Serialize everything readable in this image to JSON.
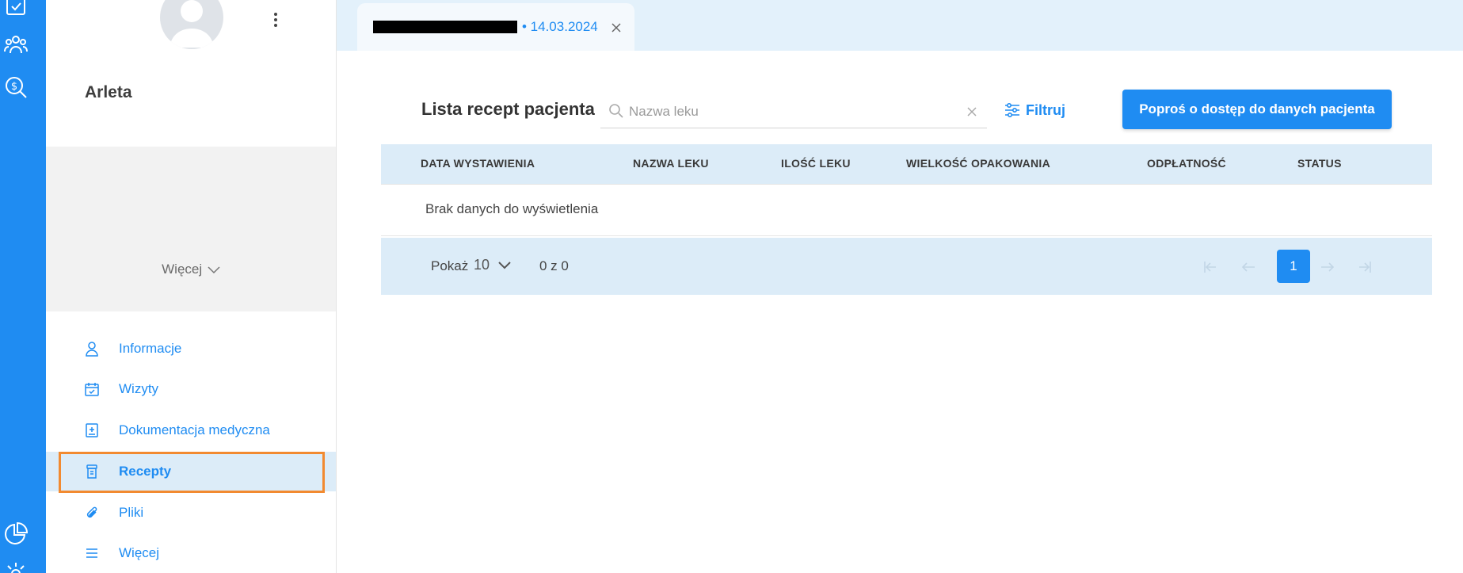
{
  "rail": {
    "icons": [
      "calendar-check-icon",
      "users-icon",
      "money-search-icon",
      "chart-pie-icon",
      "settings-icon"
    ]
  },
  "panel": {
    "patient_name": "Arleta",
    "more_toggle": "Więcej",
    "nav": [
      {
        "label": "Informacje",
        "icon": "user-icon"
      },
      {
        "label": "Wizyty",
        "icon": "calendar-check-icon"
      },
      {
        "label": "Dokumentacja medyczna",
        "icon": "medical-doc-icon"
      },
      {
        "label": "Recepty",
        "icon": "prescription-icon",
        "active": true
      },
      {
        "label": "Pliki",
        "icon": "paperclip-icon"
      },
      {
        "label": "Więcej",
        "icon": "menu-icon"
      }
    ]
  },
  "tab": {
    "date": "• 14.03.2024"
  },
  "main": {
    "title": "Lista recept pacjenta",
    "search_placeholder": "Nazwa leku",
    "filter_label": "Filtruj",
    "request_button": "Poproś o dostęp do danych pacjenta",
    "columns": [
      "DATA WYSTAWIENIA",
      "NAZWA LEKU",
      "ILOŚĆ LEKU",
      "WIELKOŚĆ OPAKOWANIA",
      "ODPŁATNOŚĆ",
      "STATUS"
    ],
    "empty_text": "Brak danych do wyświetlenia"
  },
  "pagination": {
    "show_label": "Pokaż",
    "per_page": "10",
    "range": "0 z 0",
    "current_page": "1"
  },
  "colors": {
    "accent": "#1f8cf2",
    "highlight_border": "#f28a30",
    "table_header_bg": "#dcecf8"
  }
}
